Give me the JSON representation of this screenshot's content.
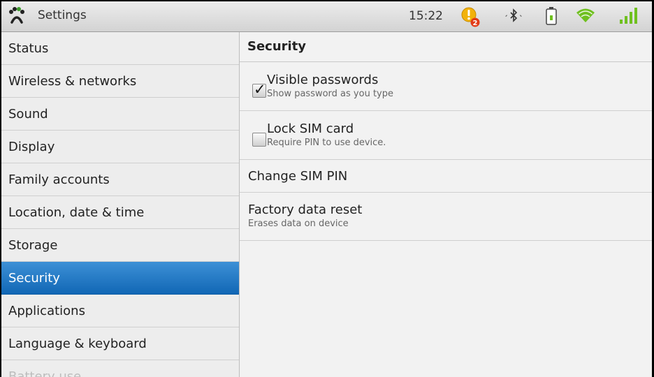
{
  "status_bar": {
    "app_title": "Settings",
    "time": "15:22",
    "notification_count": "2",
    "icons": [
      "app-logo-icon",
      "notification-warning-icon",
      "bluetooth-icon",
      "battery-icon",
      "wifi-icon",
      "signal-icon"
    ],
    "colors": {
      "wifi": "#6fc01f",
      "signal": "#6fc01f",
      "warning": "#f2b20a",
      "badge": "#e23a16"
    }
  },
  "left_menu": {
    "items": [
      {
        "label": "Status"
      },
      {
        "label": "Wireless & networks"
      },
      {
        "label": "Sound"
      },
      {
        "label": "Display"
      },
      {
        "label": "Family accounts"
      },
      {
        "label": "Location, date & time"
      },
      {
        "label": "Storage"
      },
      {
        "label": "Security",
        "selected": true
      },
      {
        "label": "Applications"
      },
      {
        "label": "Language & keyboard"
      },
      {
        "label": "Battery use"
      }
    ],
    "selected_color": "#1a72c0"
  },
  "security": {
    "header": "Security",
    "visible_passwords": {
      "title": "Visible passwords",
      "summary": "Show password as you type",
      "checked": true
    },
    "lock_sim": {
      "title": "Lock SIM card",
      "summary": "Require PIN to use device.",
      "checked": false
    },
    "change_sim_pin": {
      "title": "Change SIM PIN"
    },
    "factory_reset": {
      "title": "Factory data reset",
      "summary": "Erases data on device"
    }
  }
}
